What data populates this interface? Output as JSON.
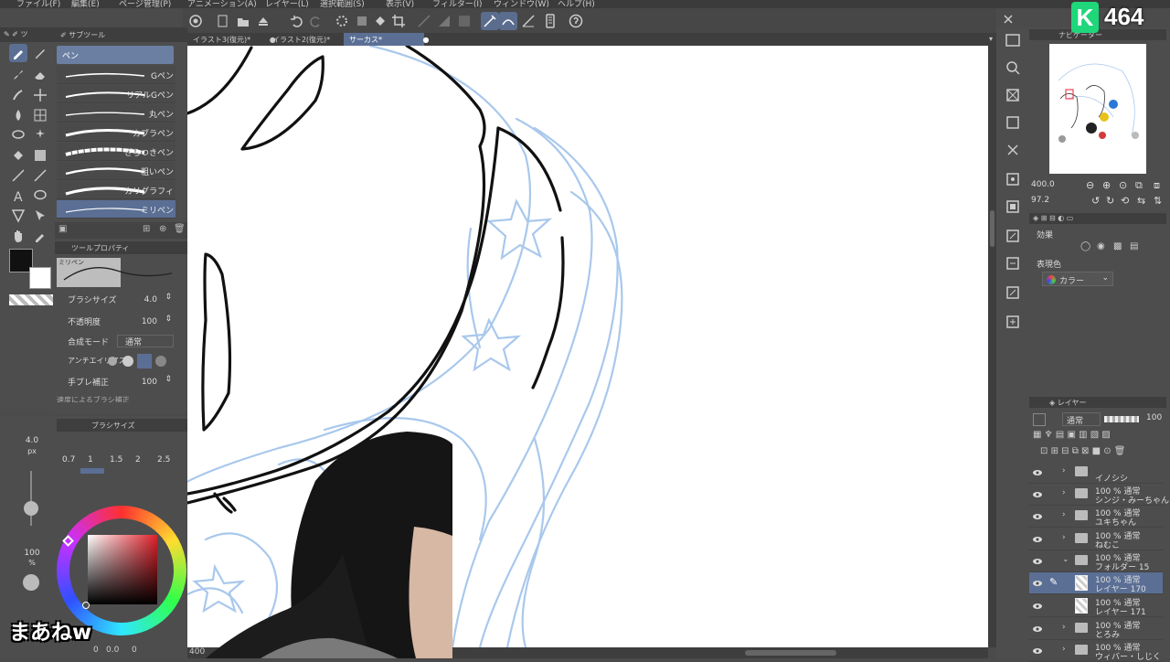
{
  "menu": [
    "ファイル(F)",
    "編集(E)",
    "ページ管理(P)",
    "アニメーション(A)",
    "レイヤー(L)",
    "選択範囲(S)",
    "表示(V)",
    "フィルター(I)",
    "ウィンドウ(W)",
    "ヘルプ(H)"
  ],
  "tabs": [
    {
      "label": "イラスト3(復元)*",
      "close": "●"
    },
    {
      "label": "イラスト2(復元)*",
      "close": "●"
    },
    {
      "label": "サーカス*",
      "close": "●"
    }
  ],
  "subtool": {
    "header": "サブツール",
    "group": "ペン",
    "items": [
      "Gペン",
      "リアルGペン",
      "丸ペン",
      "カブラペン",
      "ざらつきペン",
      "粗いペン",
      "カリグラフィ",
      "ミリペン"
    ]
  },
  "tool_property": {
    "header": "ツールプロパティ",
    "brush_name": "ミリペン",
    "rows": [
      {
        "label": "ブラシサイズ",
        "value": "4.0"
      },
      {
        "label": "不透明度",
        "value": "100"
      },
      {
        "label": "合成モード",
        "value": "通常"
      },
      {
        "label": "アンチエイリアス",
        "value": ""
      },
      {
        "label": "手ブレ補正",
        "value": "100"
      }
    ],
    "cut_label": "速度によるブラシ補正"
  },
  "brush_size": {
    "header": "ブラシサイズ",
    "current": "4.0",
    "unit": "px",
    "options": [
      "0.7",
      "1",
      "1.5",
      "2",
      "2.5"
    ],
    "opacity_value": "100",
    "opacity_unit": "%"
  },
  "navigator": {
    "header": "ナビゲーター",
    "zoom": "400.0",
    "rotation": "97.2"
  },
  "effect": {
    "header": "効果",
    "label_color": "表現色",
    "color_mode": "カラー"
  },
  "layers": {
    "header": "レイヤー",
    "blend": "通常",
    "opacity": "100",
    "rows": [
      {
        "top": "",
        "name": "イノシシ",
        "folder": true,
        "selected": false
      },
      {
        "top": "100 % 通常",
        "name": "シンジ・みーちゃん",
        "folder": true,
        "selected": false
      },
      {
        "top": "100 % 通常",
        "name": "ユキちゃん",
        "folder": true,
        "selected": false
      },
      {
        "top": "100 % 通常",
        "name": "ねむこ",
        "folder": true,
        "selected": false
      },
      {
        "top": "100 % 通常",
        "name": "フォルダー 15",
        "folder": true,
        "selected": false
      },
      {
        "top": "100 % 通常",
        "name": "レイヤー 170",
        "folder": false,
        "selected": true
      },
      {
        "top": "100 % 通常",
        "name": "レイヤー 171",
        "folder": false,
        "selected": false
      },
      {
        "top": "100 % 通常",
        "name": "とろみ",
        "folder": true,
        "selected": false
      },
      {
        "top": "100 % 通常",
        "name": "ウィバー・しじく",
        "folder": true,
        "selected": false
      }
    ]
  },
  "status": {
    "zoom": "400",
    "zero1": "0",
    "zero2": "0.0",
    "zero3": "0"
  },
  "overlay": {
    "viewer_count": "464",
    "k_badge": "K",
    "caption": "まあねw"
  },
  "colors": {
    "menubar": "#3b3b3b",
    "panel": "#4d4d4d",
    "canvas": "#ffffff",
    "sketch_blue": "#a9c8ec",
    "ink": "#111111",
    "accent": "#5b6f95",
    "badge_green": "#1fd67a"
  }
}
